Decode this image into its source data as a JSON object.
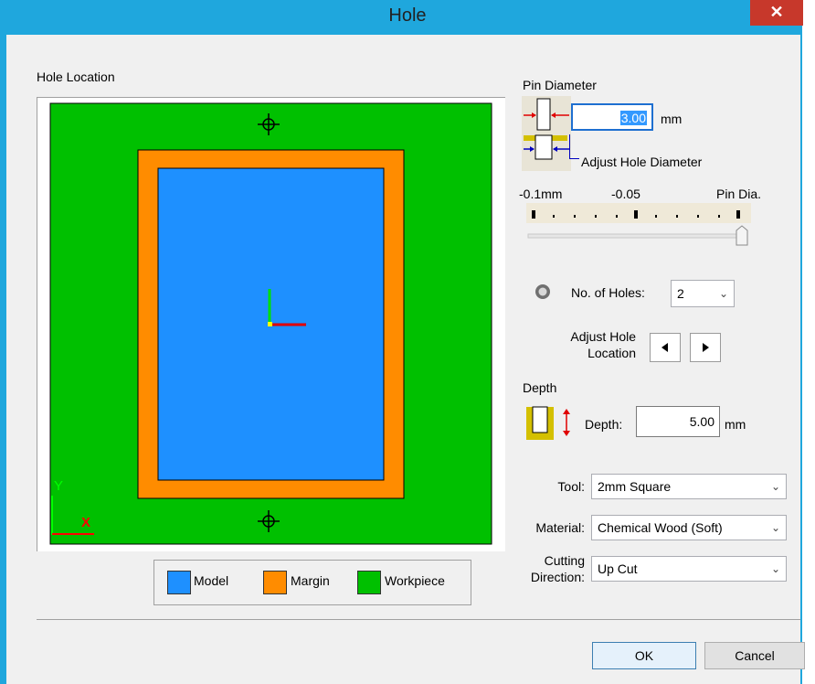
{
  "window": {
    "title": "Hole",
    "close_glyph": "✕"
  },
  "hole_location": {
    "label": "Hole Location",
    "colors": {
      "workpiece": "#00c000",
      "margin": "#ff8c00",
      "model": "#1e90ff"
    },
    "axis_labels": {
      "y": "Y",
      "x": "X"
    }
  },
  "legend": {
    "model": "Model",
    "margin": "Margin",
    "workpiece": "Workpiece"
  },
  "pin_diameter": {
    "label": "Pin Diameter",
    "value": "3.00",
    "unit": "mm",
    "adjust_label": "Adjust Hole Diameter",
    "slider_min_label": "-0.1mm",
    "slider_mid_label": "-0.05",
    "slider_max_label": "Pin Dia.",
    "slider_value": 1.0
  },
  "holes": {
    "label": "No. of Holes:",
    "selected": "2"
  },
  "adjust_location": {
    "label_line1": "Adjust Hole",
    "label_line2": "Location"
  },
  "depth": {
    "section_label": "Depth",
    "label": "Depth:",
    "value": "5.00",
    "unit": "mm"
  },
  "tool": {
    "label": "Tool:",
    "selected": "2mm Square"
  },
  "material": {
    "label": "Material:",
    "selected": "Chemical Wood (Soft)"
  },
  "cutting": {
    "label_line1": "Cutting",
    "label_line2": "Direction:",
    "selected": "Up Cut"
  },
  "buttons": {
    "ok": "OK",
    "cancel": "Cancel"
  }
}
